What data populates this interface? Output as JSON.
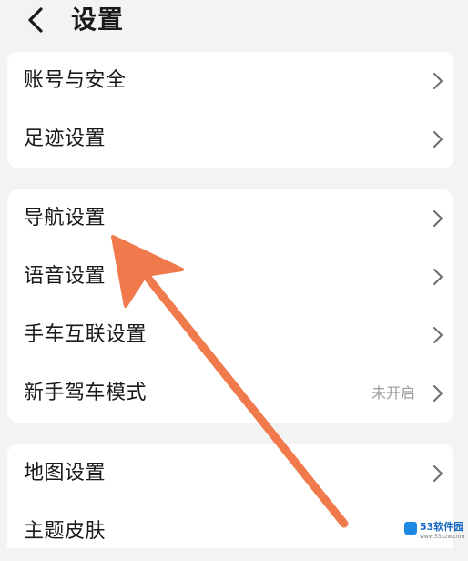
{
  "header": {
    "title": "设置",
    "back_icon": "chevron-left-icon"
  },
  "groups": [
    {
      "items": [
        {
          "label": "账号与安全",
          "value": ""
        },
        {
          "label": "足迹设置",
          "value": ""
        }
      ]
    },
    {
      "items": [
        {
          "label": "导航设置",
          "value": ""
        },
        {
          "label": "语音设置",
          "value": ""
        },
        {
          "label": "手车互联设置",
          "value": ""
        },
        {
          "label": "新手驾车模式",
          "value": "未开启"
        }
      ]
    },
    {
      "items": [
        {
          "label": "地图设置",
          "value": ""
        },
        {
          "label": "主题皮肤",
          "value": ""
        }
      ]
    }
  ],
  "overlay": {
    "arrow_color": "#f07a4c",
    "watermark_text": "53软件园",
    "watermark_sub": "www.53xzw.com"
  },
  "colors": {
    "background": "#f3f3f4",
    "card": "#ffffff",
    "text": "#1a1a1a",
    "secondary_text": "#9a9a9a"
  }
}
